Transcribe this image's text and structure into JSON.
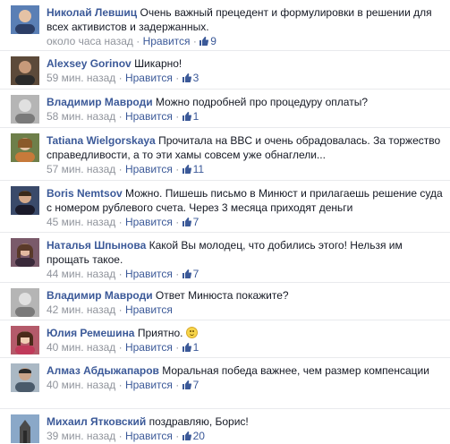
{
  "like_label": "Нравится",
  "separator": " · ",
  "comments": [
    {
      "author": "Николай Левшиц",
      "text": "Очень важный прецедент и формулировки в решении для всех активистов и задержанных.",
      "time": "около часа назад",
      "likes": "9"
    },
    {
      "author": "Alexsey Gorinov",
      "text": "Шикарно!",
      "time": "59 мин. назад",
      "likes": "3"
    },
    {
      "author": "Владимир Мавроди",
      "text": "Можно подробней про процедуру оплаты?",
      "time": "58 мин. назад",
      "likes": "1"
    },
    {
      "author": "Tatiana Wielgorskaya",
      "text": "Прочитала на BBC и очень обрадовалась. За торжество справедливости, а то эти хамы совсем уже обнаглели...",
      "time": "57 мин. назад",
      "likes": "11"
    },
    {
      "author": "Boris Nemtsov",
      "text": "Можно. Пишешь письмо в Минюст и прилагаешь решение суда с номером рублевого счета. Через 3 месяца приходят деньги",
      "time": "45 мин. назад",
      "likes": "7"
    },
    {
      "author": "Наталья Шпынова",
      "text": "Какой Вы молодец, что добились этого! Нельзя им прощать такое.",
      "time": "44 мин. назад",
      "likes": "7"
    },
    {
      "author": "Владимир Мавроди",
      "text": "Ответ Минюста покажите?",
      "time": "42 мин. назад",
      "likes": ""
    },
    {
      "author": "Юлия Ремешина",
      "text": "Приятно.",
      "time": "40 мин. назад",
      "likes": "1"
    },
    {
      "author": "Алмаз Абдыжапаров",
      "text": "Моральная победа важнее, чем размер компенсации",
      "time": "40 мин. назад",
      "likes": "7"
    },
    {
      "author": "Михаил Ятковский",
      "text": "поздравляю, Борис!",
      "time": "39 мин. назад",
      "likes": "20"
    }
  ],
  "avatars": [
    {
      "icon": "person-photo-icon",
      "bg": "#5a7fb5",
      "face": "#e5c2a5"
    },
    {
      "icon": "person-photo-icon",
      "bg": "#5c4a3a",
      "face": "#c79a7a"
    },
    {
      "icon": "person-photo-icon",
      "bg": "#9a9a9a",
      "face": "#d9d9d9"
    },
    {
      "icon": "person-photo-icon",
      "bg": "#6e7f4a",
      "face": "#e8c6a8"
    },
    {
      "icon": "person-photo-icon",
      "bg": "#3a4a6a",
      "face": "#d4a98a"
    },
    {
      "icon": "person-photo-icon",
      "bg": "#7a5a6a",
      "face": "#e2b9a0"
    },
    {
      "icon": "person-photo-icon",
      "bg": "#9a9a9a",
      "face": "#d9d9d9"
    },
    {
      "icon": "person-photo-icon",
      "bg": "#b45a6a",
      "face": "#f0cdb4"
    },
    {
      "icon": "person-photo-icon",
      "bg": "#8a9aaa",
      "face": "#c9a48a"
    },
    {
      "icon": "person-photo-icon",
      "bg": "#6a8aaa",
      "face": "#5a5a5a"
    }
  ]
}
